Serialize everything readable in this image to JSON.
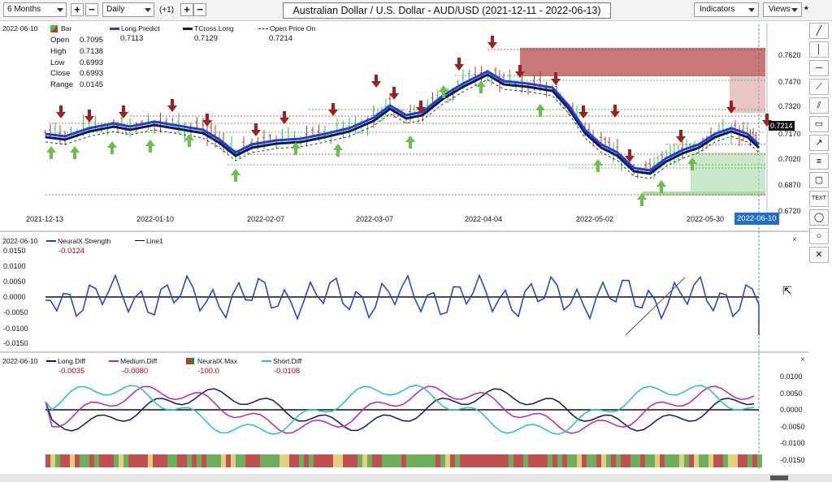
{
  "toolbar": {
    "period": "6 Months",
    "interval": "Daily",
    "offset": "(+1)",
    "plus": "+",
    "minus": "−",
    "title": "Australian Dollar / U.S. Dollar - AUD/USD (2021-12-11 - 2022-06-13)",
    "indicators": "Indicators",
    "views": "Views",
    "star": "*"
  },
  "price_panel": {
    "date": "2022-06-10",
    "bar_label": "Bar",
    "ohlc": {
      "open_label": "Open",
      "open": "0.7095",
      "high_label": "High",
      "high": "0.7138",
      "low_label": "Low",
      "low": "0.6993",
      "close_label": "Close",
      "close": "0.6993",
      "range_label": "Range",
      "range": "0.0145"
    },
    "legend": [
      {
        "name": "Long.Predict",
        "value": "0.7113",
        "color": "#1a3fe0"
      },
      {
        "name": "TCross.Long",
        "value": "0.7129",
        "color": "#0b1a4a"
      },
      {
        "name": "Open Price On",
        "value": "0.7214",
        "color": "#222222"
      }
    ],
    "y_ticks": [
      "0.7620",
      "0.7470",
      "0.7320",
      "0.7170",
      "0.7020",
      "0.6870",
      "0.6720"
    ],
    "last_price": "0.7214",
    "x_ticks": [
      "2021-12-13",
      "2022-01-10",
      "2022-02-07",
      "2022-03-07",
      "2022-04-04",
      "2022-05-02",
      "2022-05-30"
    ],
    "current_date": "2022-06-10"
  },
  "strength_panel": {
    "date": "2022-06-10",
    "legend": [
      {
        "name": "NeuralX.Strength",
        "value": "-0.0124",
        "color": "#1a3fe0"
      },
      {
        "name": "Line1",
        "value": "",
        "color": "#111111"
      }
    ],
    "y_ticks": [
      "0.0150",
      "0.0100",
      "0.0050",
      "0.0000",
      "-0.0050",
      "-0.0100",
      "-0.0150"
    ]
  },
  "diff_panel": {
    "date": "2022-06-10",
    "legend": [
      {
        "name": "Long.Diff",
        "value": "-0.0035",
        "color": "#0b1a6a"
      },
      {
        "name": "Medium.Diff",
        "value": "-0.0080",
        "color": "#c020c0"
      },
      {
        "name": "NeuralX.Max",
        "value": "-100.0",
        "color": "#2a8a2a"
      },
      {
        "name": "Short.Diff",
        "value": "-0.0108",
        "color": "#20c0d0"
      }
    ],
    "y_ticks": [
      "0.0100",
      "0.0050",
      "0.0000",
      "-0.0050",
      "-0.0100",
      "-0.0150"
    ]
  },
  "side_tools": [
    "pen-icon",
    "vertical-line-icon",
    "horizontal-line-icon",
    "ray-icon",
    "channel-icon",
    "rectangle-icon",
    "arrow-icon",
    "fibonacci-icon",
    "callout-icon",
    "flag-icon",
    "text-icon",
    "ellipse-icon",
    "circle-icon",
    "close-icon"
  ],
  "close_symbol": "×",
  "colors": {
    "bull": "#2ecc40",
    "bear": "#c0392b",
    "up_arrow": "#6bbf4a",
    "down_arrow": "#a02020",
    "long_predict": "#1a3fe0",
    "tcross": "#0b1a4a"
  }
}
